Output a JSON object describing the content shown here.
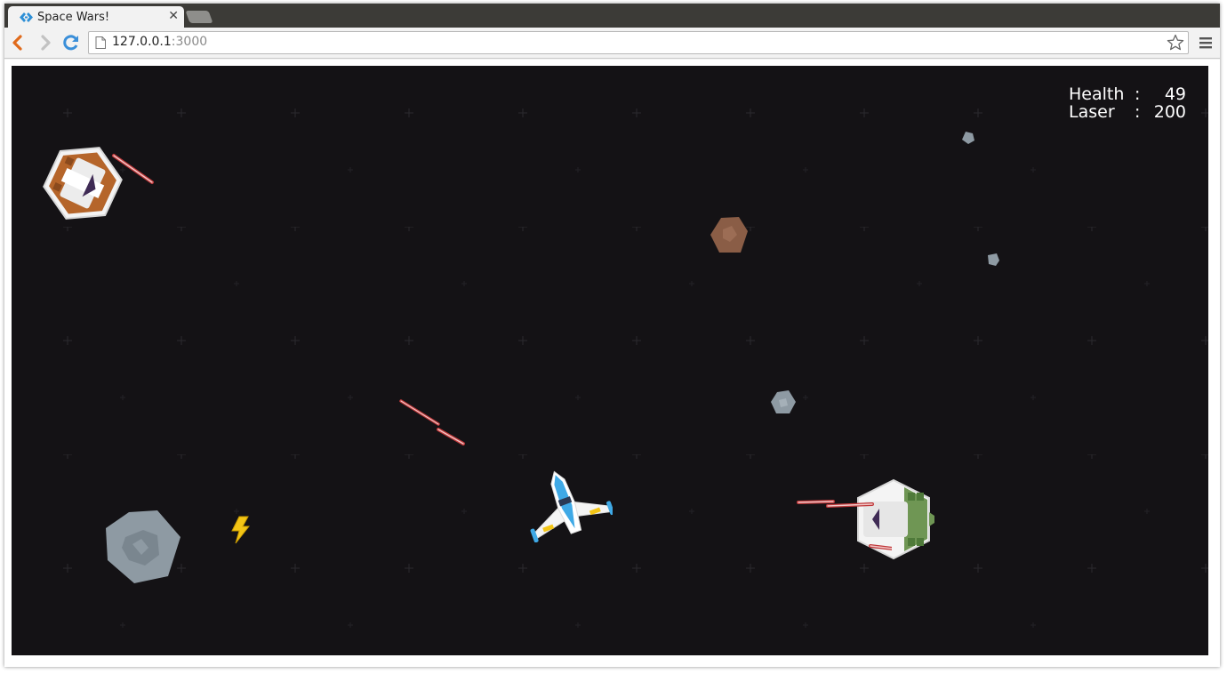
{
  "browser": {
    "tab": {
      "title": "Space Wars!"
    },
    "url": {
      "host": "127.0.0.1",
      "port": ":3000"
    }
  },
  "hud": {
    "health_label": "Health",
    "health_value": "49",
    "laser_label": "Laser",
    "laser_value": "200",
    "separator": ":"
  },
  "colors": {
    "space_background": "#141215",
    "player_ship": "#3fa9e6",
    "enemy_orange": "#b5652a",
    "enemy_green": "#6f9654",
    "laser": "#c0393b",
    "lightning_powerup": "#f3c515",
    "asteroid_grey": "#8e9aa3",
    "asteroid_brown": "#8a5d46"
  },
  "icons": [
    "back-arrow-icon",
    "forward-arrow-icon",
    "reload-icon",
    "page-icon",
    "bookmark-star-icon",
    "menu-icon",
    "lightning-icon"
  ]
}
